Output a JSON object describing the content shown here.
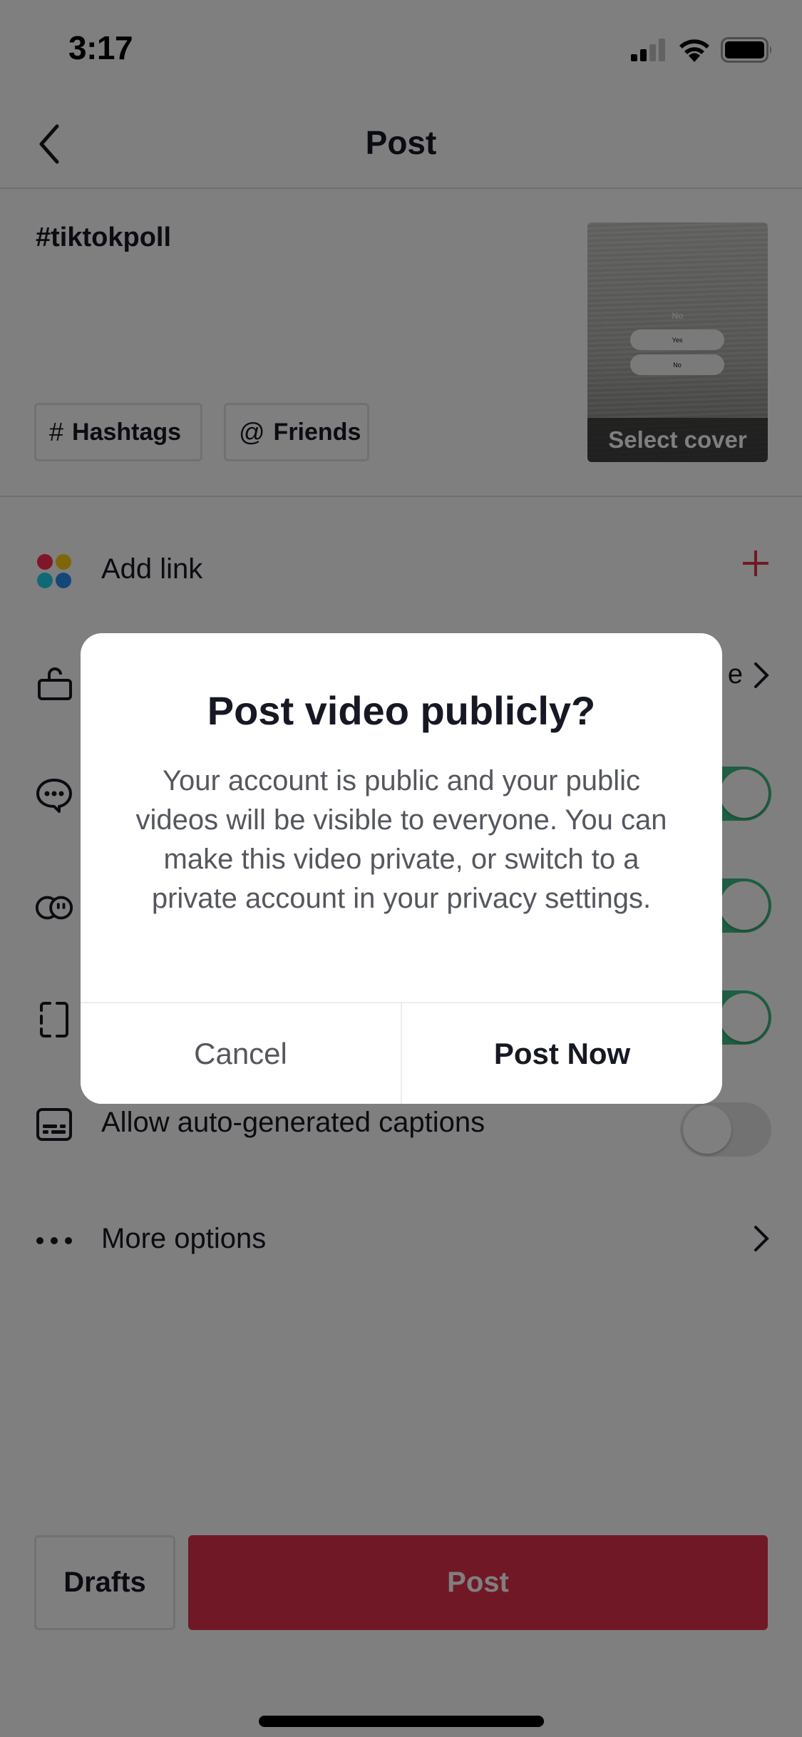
{
  "status_bar": {
    "time": "3:17",
    "signal_bars_active": 2,
    "signal_bars_total": 4,
    "battery_level": "full"
  },
  "nav": {
    "back_icon": "chevron-left-icon",
    "title": "Post"
  },
  "caption": {
    "text": "#tiktokpoll"
  },
  "chips": [
    {
      "symbol": "#",
      "label": "Hashtags",
      "icon": "hashtag-icon"
    },
    {
      "symbol": "@",
      "label": "Friends",
      "icon": "at-icon"
    }
  ],
  "cover": {
    "poll_question": "No",
    "poll_options": [
      "Yes",
      "No"
    ],
    "select_label": "Select cover"
  },
  "rows": {
    "add_link": {
      "label": "Add link",
      "icon": "colored-dots-icon",
      "action_icon": "plus-icon"
    },
    "privacy": {
      "icon": "unlock-icon",
      "value_fragment": "e",
      "action_icon": "chevron-right-icon"
    },
    "comments": {
      "icon": "comment-icon",
      "toggle_on": true
    },
    "duet": {
      "icon": "duet-icon",
      "toggle_on": true
    },
    "stitch": {
      "icon": "stitch-icon",
      "toggle_on": true
    },
    "captions": {
      "label": "Allow auto-generated captions",
      "icon": "captions-icon",
      "toggle_on": false
    },
    "more_options": {
      "label": "More options",
      "icon": "more-dots-icon",
      "action_icon": "chevron-right-icon"
    }
  },
  "bottom": {
    "drafts_label": "Drafts",
    "post_label": "Post"
  },
  "dialog": {
    "title": "Post video publicly?",
    "body": "Your account is public and your public videos will be visible to everyone. You can make this video private, or switch to a private account in your privacy settings.",
    "cancel_label": "Cancel",
    "confirm_label": "Post Now"
  },
  "colors": {
    "accent_red": "#e2314c",
    "toggle_green": "#3dbf85",
    "text_primary": "#161823",
    "overlay": "rgba(0,0,0,0.5)"
  }
}
